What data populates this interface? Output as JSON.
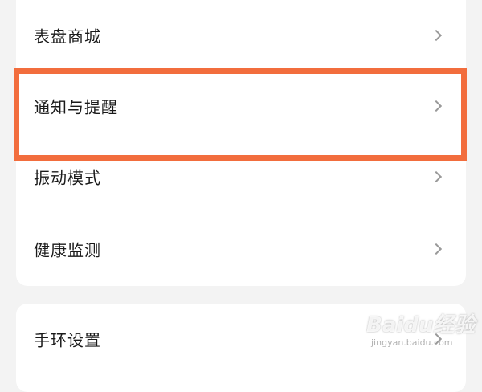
{
  "settings": {
    "group1": [
      {
        "label": "表盘商城",
        "icon": "chevron-right-icon"
      },
      {
        "label": "通知与提醒",
        "icon": "chevron-right-icon"
      },
      {
        "label": "振动模式",
        "icon": "chevron-right-icon"
      },
      {
        "label": "健康监测",
        "icon": "chevron-right-icon"
      }
    ],
    "group2": [
      {
        "label": "手环设置",
        "icon": "chevron-right-icon"
      }
    ]
  },
  "highlight": {
    "color": "#f26d3d",
    "target": "通知与提醒"
  },
  "watermark": {
    "logo": "Baidu经验",
    "sub": "jingyan.baidu.com"
  }
}
